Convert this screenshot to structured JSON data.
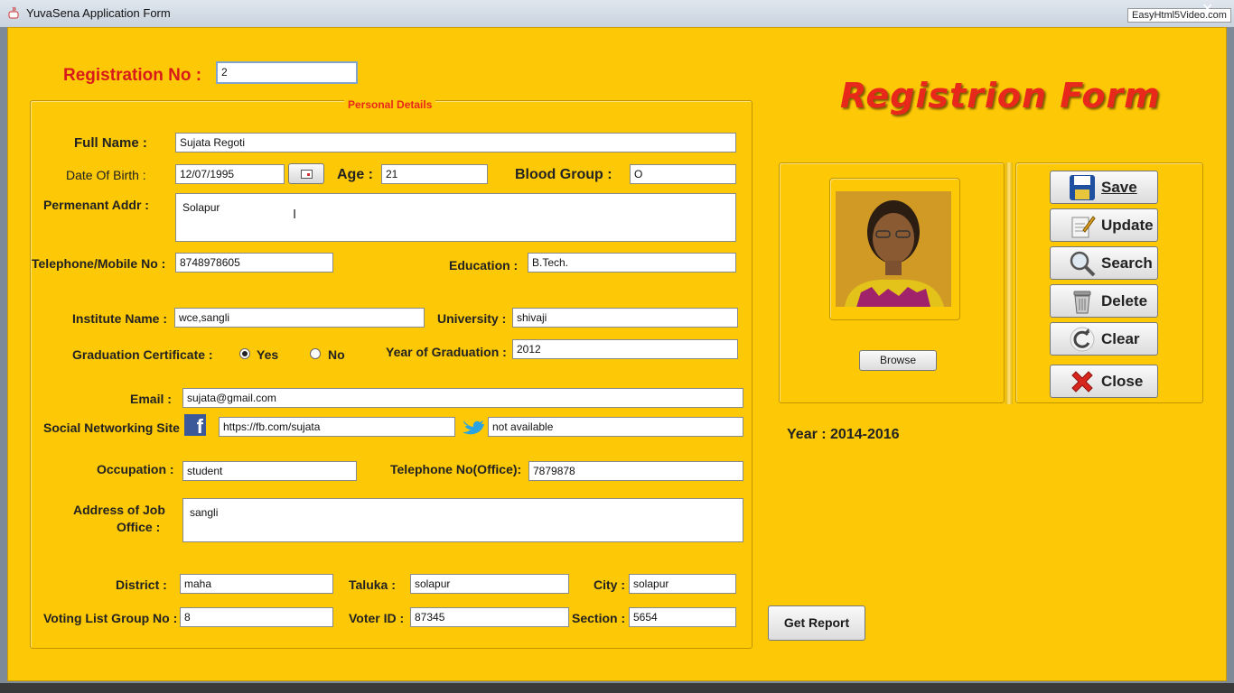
{
  "window": {
    "title": "YuvaSena Application Form",
    "watermark": "EasyHtml5Video.com"
  },
  "form_heading": "Registrion Form",
  "registration": {
    "label": "Registration No :",
    "value": "2"
  },
  "group_title": "Personal Details",
  "fields": {
    "full_name": {
      "label": "Full Name :",
      "value": "Sujata Regoti"
    },
    "dob": {
      "label": "Date Of Birth :",
      "value": "12/07/1995"
    },
    "age": {
      "label": "Age :",
      "value": "21"
    },
    "blood_group": {
      "label": "Blood Group :",
      "value": "O"
    },
    "address": {
      "label": "Permenant Addr  :",
      "value": "Solapur"
    },
    "telephone": {
      "label": "Telephone/Mobile No :",
      "value": "8748978605"
    },
    "education": {
      "label": "Education :",
      "value": "B.Tech."
    },
    "institute": {
      "label": "Institute Name :",
      "value": "wce,sangli"
    },
    "university": {
      "label": "University :",
      "value": "shivaji"
    },
    "grad_cert": {
      "label": "Graduation Certificate :",
      "yes": "Yes",
      "no": "No",
      "selected": "Yes"
    },
    "year_grad": {
      "label": "Year of Graduation :",
      "value": "2012"
    },
    "email": {
      "label": "Email :",
      "value": "sujata@gmail.com"
    },
    "social": {
      "label": "Social Networking Site",
      "facebook": "https://fb.com/sujata",
      "twitter": "not available"
    },
    "occupation": {
      "label": "Occupation :",
      "value": "student"
    },
    "office_phone": {
      "label": "Telephone No(Office):",
      "value": "7879878"
    },
    "job_address": {
      "label_line1": "Address of Job",
      "label_line2": "Office :",
      "value": "sangli"
    },
    "district": {
      "label": "District  :",
      "value": "maha"
    },
    "taluka": {
      "label": "Taluka :",
      "value": "solapur"
    },
    "city": {
      "label": "City :",
      "value": "solapur"
    },
    "voting_group": {
      "label": "Voting List Group No :",
      "value": "8"
    },
    "voter_id": {
      "label": "Voter ID :",
      "value": "87345"
    },
    "section": {
      "label": "Section :",
      "value": "5654"
    }
  },
  "photo": {
    "browse_label": "Browse"
  },
  "actions": {
    "save": "Save",
    "update": "Update",
    "search": "Search",
    "delete": "Delete",
    "clear": "Clear",
    "close": "Close"
  },
  "year_text": "Year : 2014-2016",
  "get_report": "Get Report",
  "colors": {
    "background": "#fdc805",
    "heading": "#e8281b",
    "group_title": "#e8281b"
  }
}
